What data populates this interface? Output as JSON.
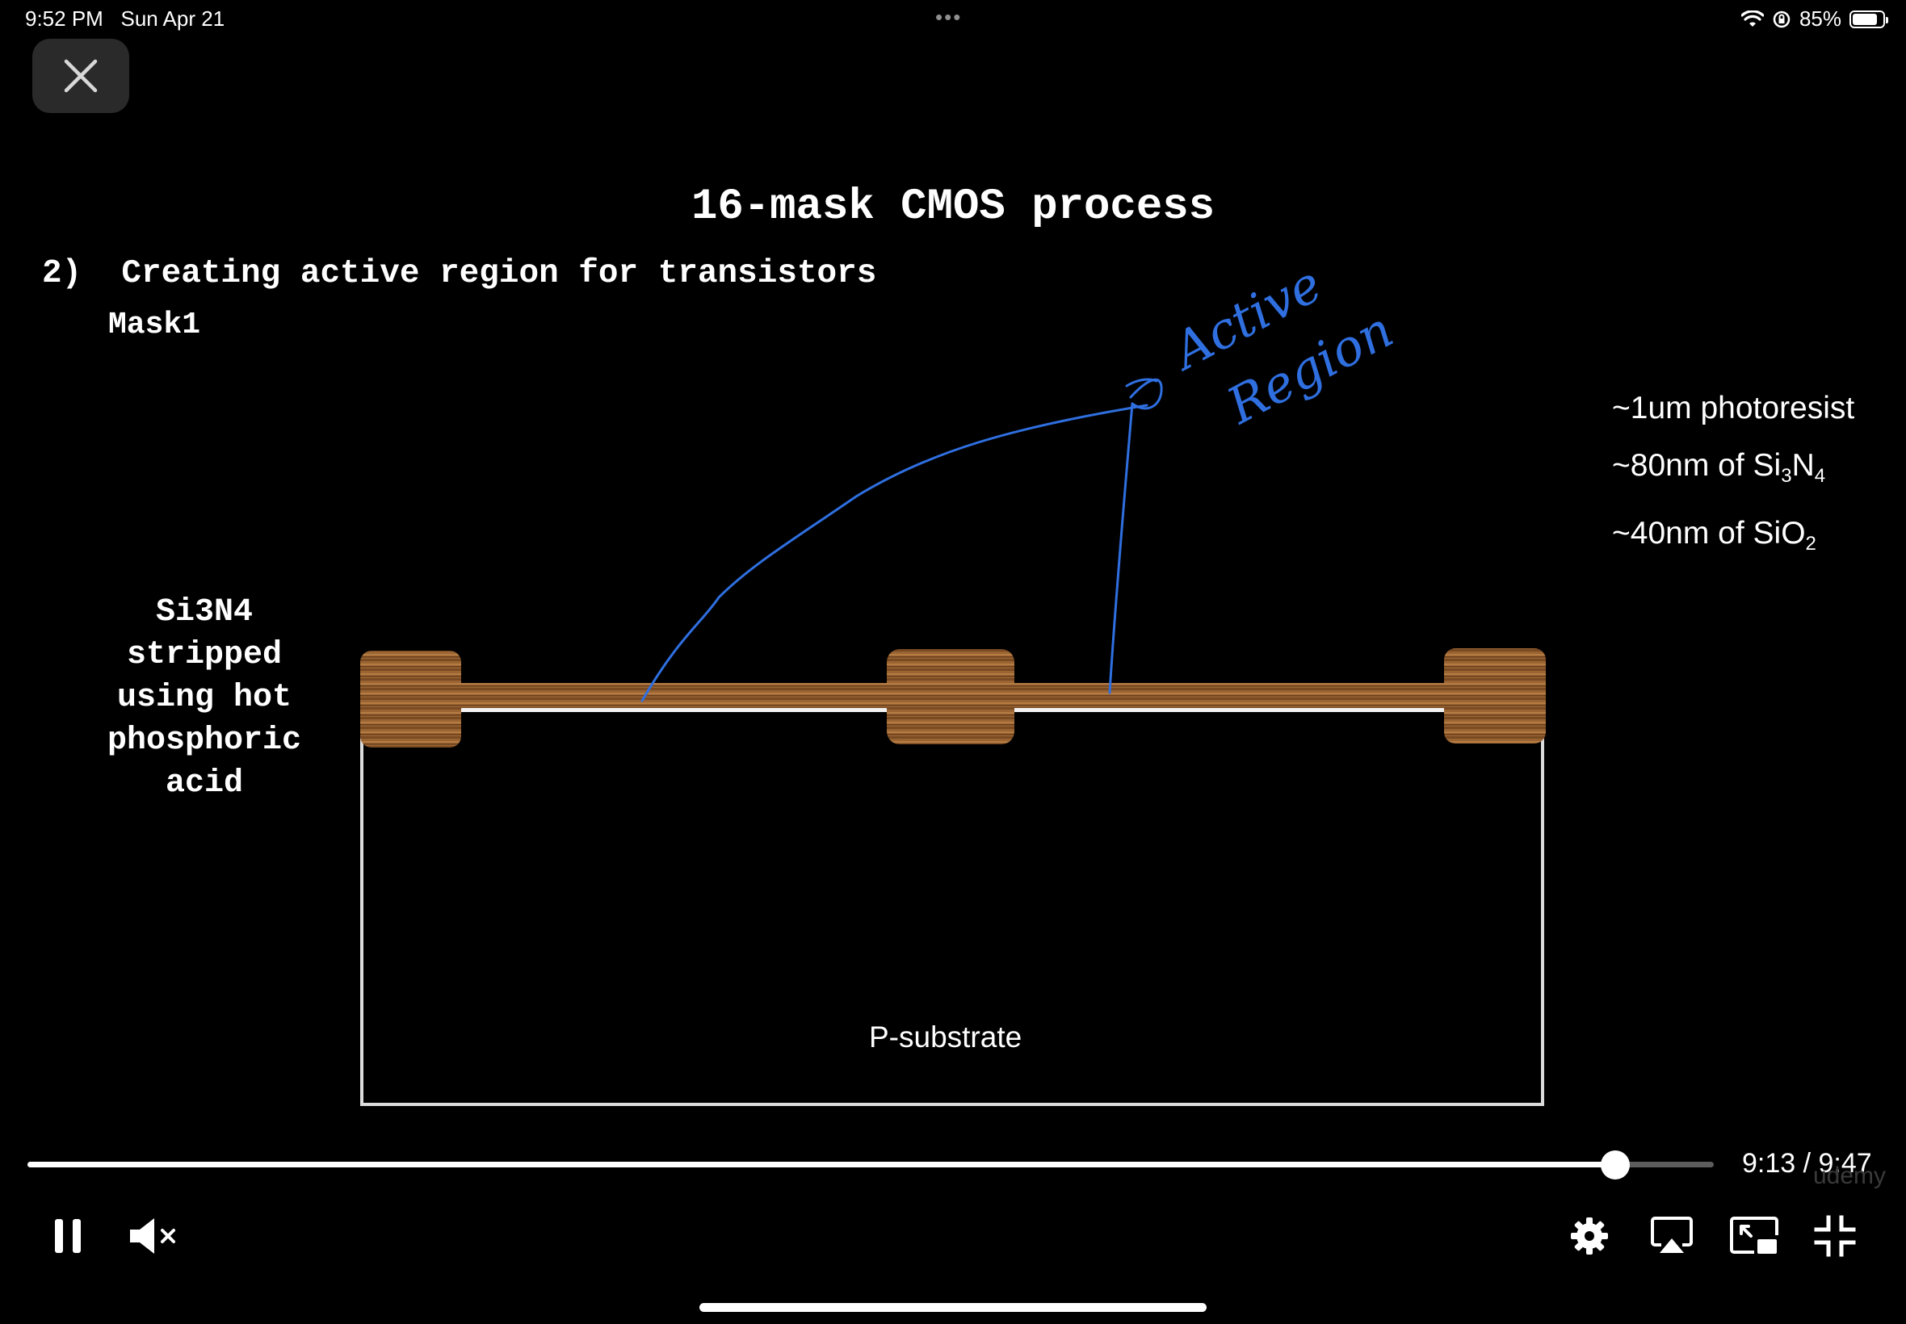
{
  "status_bar": {
    "time": "9:52 PM",
    "date": "Sun Apr 21",
    "dots": "•••",
    "battery_percent": "85%",
    "battery_level": 0.85,
    "icons": [
      "wifi-icon",
      "orientation-lock-icon",
      "battery-icon"
    ]
  },
  "player": {
    "close_icon": "close-icon",
    "current_time": "9:13",
    "total_time": "9:47",
    "time_readout": "9:13 / 9:47",
    "progress_fraction": 0.9416,
    "watermark": "udemy",
    "controls": [
      "pause-icon",
      "mute-icon",
      "settings-icon",
      "airplay-icon",
      "picture-in-picture-icon",
      "exit-fullscreen-icon"
    ]
  },
  "slide": {
    "title": "16-mask CMOS process",
    "step": "2)  Creating active region for transistors",
    "mask": "Mask1",
    "side_note": [
      "Si3N4",
      "stripped",
      "using hot",
      "phosphoric",
      "acid"
    ],
    "legend": {
      "photoresist": "~1um photoresist",
      "nitride_prefix": "~80nm of Si",
      "nitride_sub1": "3",
      "nitride_mid": "N",
      "nitride_sub2": "4",
      "oxide_prefix": "~40nm of SiO",
      "oxide_sub": "2"
    },
    "substrate_label": "P-substrate",
    "annotation": "Active Region",
    "colors": {
      "photoresist": "#8a5a2b",
      "ink": "#2f6fe0",
      "substrate_border": "#e0e0e0"
    }
  }
}
